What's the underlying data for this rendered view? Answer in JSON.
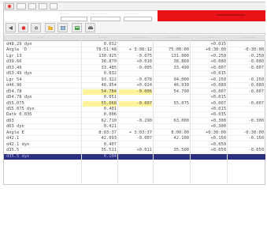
{
  "menubar": {
    "items": [
      "",
      "",
      "",
      "",
      ""
    ]
  },
  "filters": {
    "label_a": "·····",
    "label_b": "··········",
    "label_c": "········"
  },
  "toolbar": {
    "buttons": [
      "back-icon",
      "stop-icon",
      "settings-icon",
      "folder-icon",
      "grid-icon",
      "export-icon",
      "print-icon"
    ],
    "alert_color": "#e8141a"
  },
  "table": {
    "columns": [
      "····",
      "·····",
      "········",
      "·······",
      "······",
      "·······"
    ],
    "rows": [
      {
        "c0": "d48.29  dyn",
        "c1": "0.032",
        "c2": "",
        "c3": "",
        "c4": "+0.015",
        "c5": ""
      },
      {
        "c0": "Angle 'D",
        "c1": "78:51:48",
        "c2": "+ 3:08:12",
        "c3": "75:00:00",
        "c4": "+0:30:00",
        "c5": "-0:30:00"
      },
      {
        "c0": "Lgr 13",
        "c1": "130.925",
        "c2": "-0.075",
        "c3": "131.000",
        "c4": "+0.250",
        "c5": "-0.250"
      },
      {
        "c0": "d39.66",
        "c1": "38.870",
        "c2": "+0.010",
        "c3": "38.860",
        "c4": "+0.080",
        "c5": "-0.080"
      },
      {
        "c0": "d53.49",
        "c1": "33.485",
        "c2": "-0.005",
        "c3": "33.490",
        "c4": "+0.007",
        "c5": "-0.007"
      },
      {
        "c0": "d53.49  dyn",
        "c1": "0.032",
        "c2": "",
        "c3": "",
        "c4": "+0.015",
        "c5": ""
      },
      {
        "c0": "Lgr 54",
        "c1": "93.322",
        "c2": "-0.078",
        "c3": "94.000",
        "c4": "+0.250",
        "c5": "-0.250"
      },
      {
        "c0": "d46.96",
        "c1": "46.954",
        "c2": "+0.024",
        "c3": "46.930",
        "c4": "+0.080",
        "c5": "-0.080"
      },
      {
        "c0": "d54.78",
        "c1": "54.784",
        "c2": "-0.006",
        "c3": "54.790",
        "c4": "+0.007",
        "c5": "-0.007",
        "hl": true
      },
      {
        "c0": "d54.78  dyn",
        "c1": "0.051",
        "c2": "",
        "c3": "",
        "c4": "+0.015",
        "c5": ""
      },
      {
        "c0": "d55.075",
        "c1": "55.068",
        "c2": "-0.007",
        "c3": "55.075",
        "c4": "+0.007",
        "c5": "-0.007",
        "hl": true
      },
      {
        "c0": "d55.075 dyn",
        "c1": "0.401",
        "c2": "",
        "c3": "",
        "c4": "+0.015",
        "c5": ""
      },
      {
        "c0": "Datk  0.035",
        "c1": "0.006",
        "c2": "",
        "c3": "",
        "c4": "+0.035",
        "c5": ""
      },
      {
        "c0": "d63",
        "c1": "62.710",
        "c2": "-0.290",
        "c3": "63.000",
        "c4": "+0.300",
        "c5": "-0.300"
      },
      {
        "c0": "d63  dyn",
        "c1": "0.421",
        "c2": "",
        "c3": "",
        "c4": "+0.300",
        "c5": ""
      },
      {
        "c0": "Angle  E",
        "c1": "8:03:37",
        "c2": "+ 3:03:37",
        "c3": "8:00:00",
        "c4": "+0:30:00",
        "c5": "-0:30:00"
      },
      {
        "c0": "d42.1",
        "c1": "42.093",
        "c2": "-0.007",
        "c3": "42.100",
        "c4": "+0.150",
        "c5": "-0.150"
      },
      {
        "c0": "d42.1  dyn",
        "c1": "0.407",
        "c2": "",
        "c3": "",
        "c4": "+0.050",
        "c5": ""
      },
      {
        "c0": "d35.5",
        "c1": "35.511",
        "c2": "+0.011",
        "c3": "35.500",
        "c4": "+0.050",
        "c5": "-0.050"
      },
      {
        "c0": "d35.5  dyn",
        "c1": "0.104",
        "c2": "",
        "c3": "",
        "c4": "",
        "c5": "",
        "sel": true
      }
    ]
  }
}
